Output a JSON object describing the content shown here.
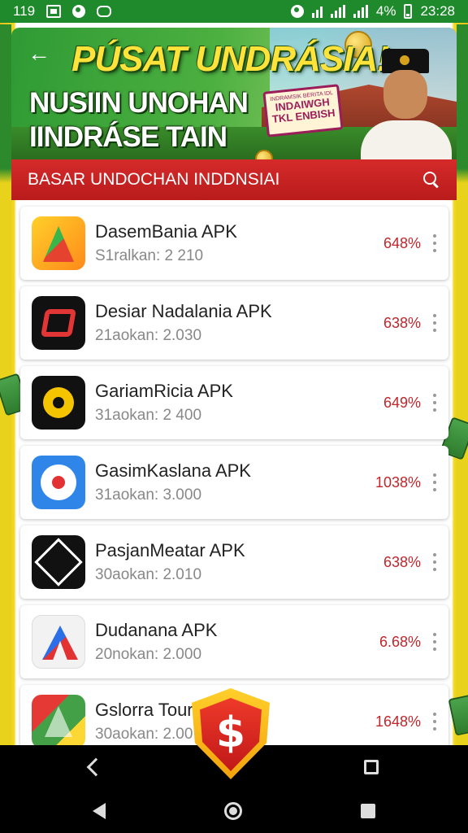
{
  "status_bar": {
    "left_time": "119",
    "battery_percent": "4%",
    "clock": "23:28"
  },
  "banner": {
    "title": "PÚSAT UNDRÁSIA!",
    "subtitle_line1": "NUSIIN UNOHAN",
    "subtitle_line2": "IINDRÁSE TAIN",
    "promo_small": "INDRAMSIK BERITA IDL",
    "promo_line1": "INDAIWGH",
    "promo_line2": "TKL ENBISH"
  },
  "section": {
    "title": "BASAR UNDOCHAN INDDNSIAI"
  },
  "apps": [
    {
      "name": "DasemBania APK",
      "sub": "S1ralkan: 2 210",
      "pct": "648%",
      "icon": "triangle-logo-icon"
    },
    {
      "name": "Desiar Nadalania APK",
      "sub": "21aokan: 2.030",
      "pct": "638%",
      "icon": "link-logo-icon"
    },
    {
      "name": "GariamRicia APK",
      "sub": "31aokan: 2 400",
      "pct": "649%",
      "icon": "gear-logo-icon"
    },
    {
      "name": "GasimKaslana APK",
      "sub": "31aokan: 3.000",
      "pct": "1038%",
      "icon": "target-logo-icon"
    },
    {
      "name": "PasjanMeatar APK",
      "sub": "30aokan: 2.010",
      "pct": "638%",
      "icon": "diamond-logo-icon"
    },
    {
      "name": "Dudanana APK",
      "sub": "20nokan: 2.000",
      "pct": "6.68%",
      "icon": "letter-a-logo-icon"
    },
    {
      "name": "Gslorra Tour",
      "sub": "30aokan: 2.00",
      "pct": "1648%",
      "icon": "colorful-triangle-icon"
    }
  ],
  "badge": {
    "symbol": "$"
  },
  "colors": {
    "status_bar": "#1f8a2c",
    "section_bar": "#c62222",
    "percent_text": "#c0262c",
    "title_yellow": "#ffe23a"
  }
}
